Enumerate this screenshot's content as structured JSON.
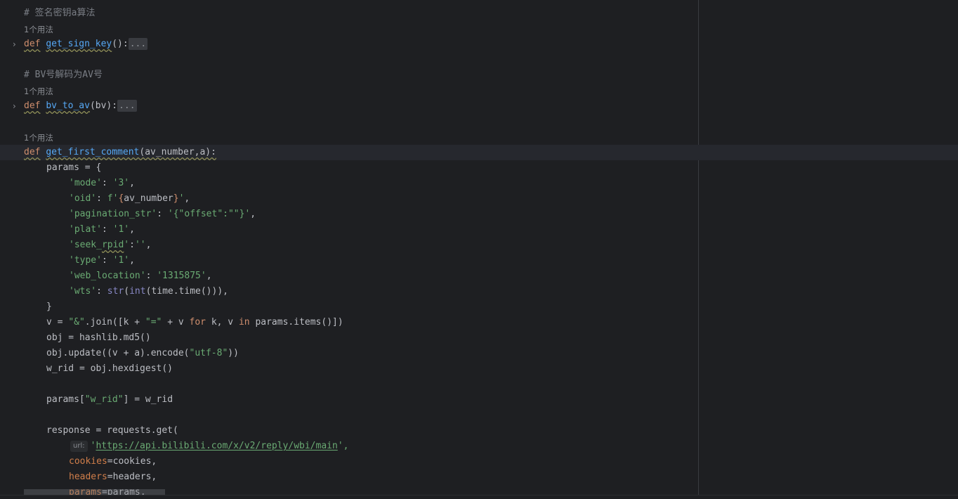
{
  "editor": {
    "lines": {
      "l1": "# 签名密钥a算法",
      "l2": "1个用法",
      "l3_kw": "def",
      "l3_fn": "get_sign_key",
      "l3_rest": "():",
      "l3_fold": "...",
      "l4": "# BV号解码为AV号",
      "l5": "1个用法",
      "l6_kw": "def",
      "l6_fn": "bv_to_av",
      "l6_rest": "(bv):",
      "l6_fold": "...",
      "l7": "1个用法",
      "l8_kw": "def",
      "l8_fn": "get_first_comment",
      "l8_rest": "(av_number,a):",
      "l9": "params = {",
      "l10_k": "'mode'",
      "l10_v": "'3'",
      "l11_k": "'oid'",
      "l11_f": "f'",
      "l11_lb": "{",
      "l11_var": "av_number",
      "l11_rb": "}",
      "l11_q": "'",
      "l12_k": "'pagination_str'",
      "l12_v": "'{\"offset\":\"\"}'",
      "l13_k": "'plat'",
      "l13_v": "'1'",
      "l14_k1": "'seek_",
      "l14_k2": "rpid",
      "l14_k3": "'",
      "l14_v": "''",
      "l15_k": "'type'",
      "l15_v": "'1'",
      "l16_k": "'web_location'",
      "l16_v": "'1315875'",
      "l17_k": "'wts'",
      "l17_str": "str",
      "l17_int": "int",
      "l17_rest": "(time.time())),",
      "l18": "}",
      "l19_a": "v = ",
      "l19_s1": "\"&\"",
      "l19_b": ".join([k + ",
      "l19_s2": "\"=\"",
      "l19_c": " + v ",
      "l19_for": "for",
      "l19_d": " k, v ",
      "l19_in": "in",
      "l19_e": " params.items()])",
      "l20": "obj = hashlib.md5()",
      "l21_a": "obj.update((v + a).encode(",
      "l21_s": "\"utf-8\"",
      "l21_b": "))",
      "l22": "w_rid = obj.hexdigest()",
      "l23_a": "params[",
      "l23_s": "\"w_rid\"",
      "l23_b": "] = w_rid",
      "l24": "response = requests.get(",
      "l25_hint": "url:",
      "l25_q1": "'",
      "l25_url": "https://api.bilibili.com/x/v2/reply/wbi/main",
      "l25_q2": "',",
      "l26_k": "cookies",
      "l26_v": "=cookies,",
      "l27_k": "headers",
      "l27_v": "=headers,",
      "l28_k": "params",
      "l28_v": "=params,"
    }
  },
  "colors": {
    "background": "#1e1f22",
    "keyword": "#cf8e6d",
    "function": "#56a8f5",
    "string": "#6aab73",
    "comment": "#7a7e85"
  }
}
